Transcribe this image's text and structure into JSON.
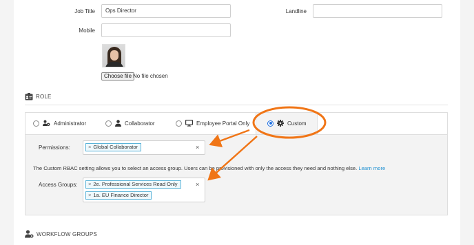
{
  "profile": {
    "job_title_label": "Job Title",
    "job_title_value": "Ops Director",
    "landline_label": "Landline",
    "landline_value": "",
    "mobile_label": "Mobile",
    "mobile_value": "",
    "choose_file_label": "Choose file",
    "no_file_text": "No file chosen"
  },
  "role": {
    "heading": "ROLE",
    "options": [
      {
        "label": "Administrator",
        "icon": "users-cog-icon",
        "selected": false
      },
      {
        "label": "Collaborator",
        "icon": "user-icon",
        "selected": false
      },
      {
        "label": "Employee Portal Only",
        "icon": "monitor-icon",
        "selected": false
      },
      {
        "label": "Custom",
        "icon": "gear-icon",
        "selected": true
      }
    ],
    "permissions_label": "Permissions:",
    "permissions_tags": [
      "Global Collaborator"
    ],
    "info_text": "The Custom RBAC setting allows you to select an access group. Users can be provisioned with only the access they need and nothing else.",
    "learn_more": "Learn more",
    "access_groups_label": "Access Groups:",
    "access_groups_tags": [
      "2e. Professional Services Read Only",
      "1a. EU Finance Director"
    ]
  },
  "workflow": {
    "heading": "WORKFLOW GROUPS"
  },
  "colors": {
    "highlight": "#f07516",
    "link": "#1d8fd1",
    "radio_selected": "#1d6fe0",
    "tag_border": "#5ab3d8"
  }
}
